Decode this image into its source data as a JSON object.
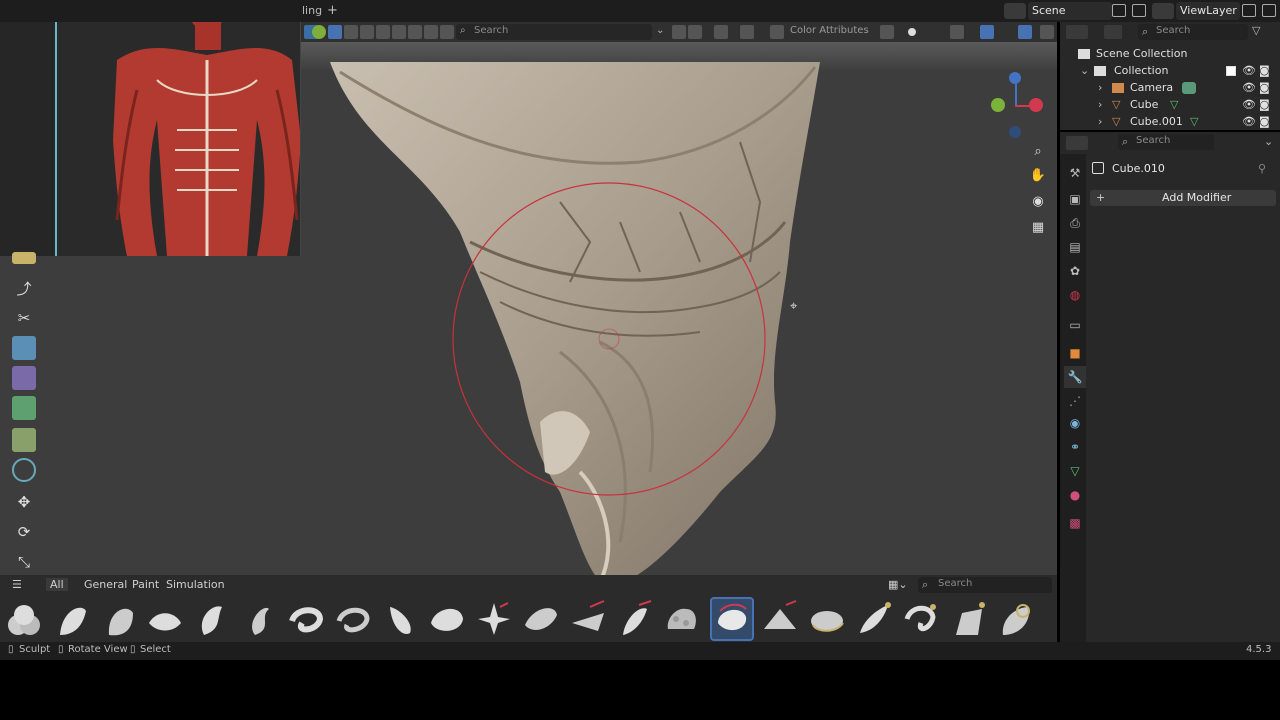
{
  "topbar": {
    "workspace_tab": "ling",
    "add_tab": "+",
    "scene_label": "Scene",
    "viewlayer_label": "ViewLayer"
  },
  "viewport_header": {
    "search_placeholder": "Search",
    "color_attributes": "Color Attributes"
  },
  "outliner": {
    "search_placeholder": "Search",
    "scene_collection": "Scene Collection",
    "collection": "Collection",
    "items": [
      {
        "label": "Camera"
      },
      {
        "label": "Cube"
      },
      {
        "label": "Cube.001"
      }
    ]
  },
  "properties": {
    "search_placeholder": "Search",
    "object_name": "Cube.010",
    "add_modifier": "Add Modifier"
  },
  "shelf": {
    "tabs": [
      "All",
      "General",
      "Paint",
      "Simulation"
    ],
    "search_placeholder": "Search"
  },
  "statusbar": {
    "sculpt": "Sculpt",
    "rotate_view": "Rotate View",
    "select": "Select",
    "version": "4.5.3"
  },
  "colors": {
    "viewport_bg": "#3d3d3d",
    "panel_bg": "#282828",
    "accent": "#4772b3",
    "brush_cursor": "#c8323c"
  }
}
